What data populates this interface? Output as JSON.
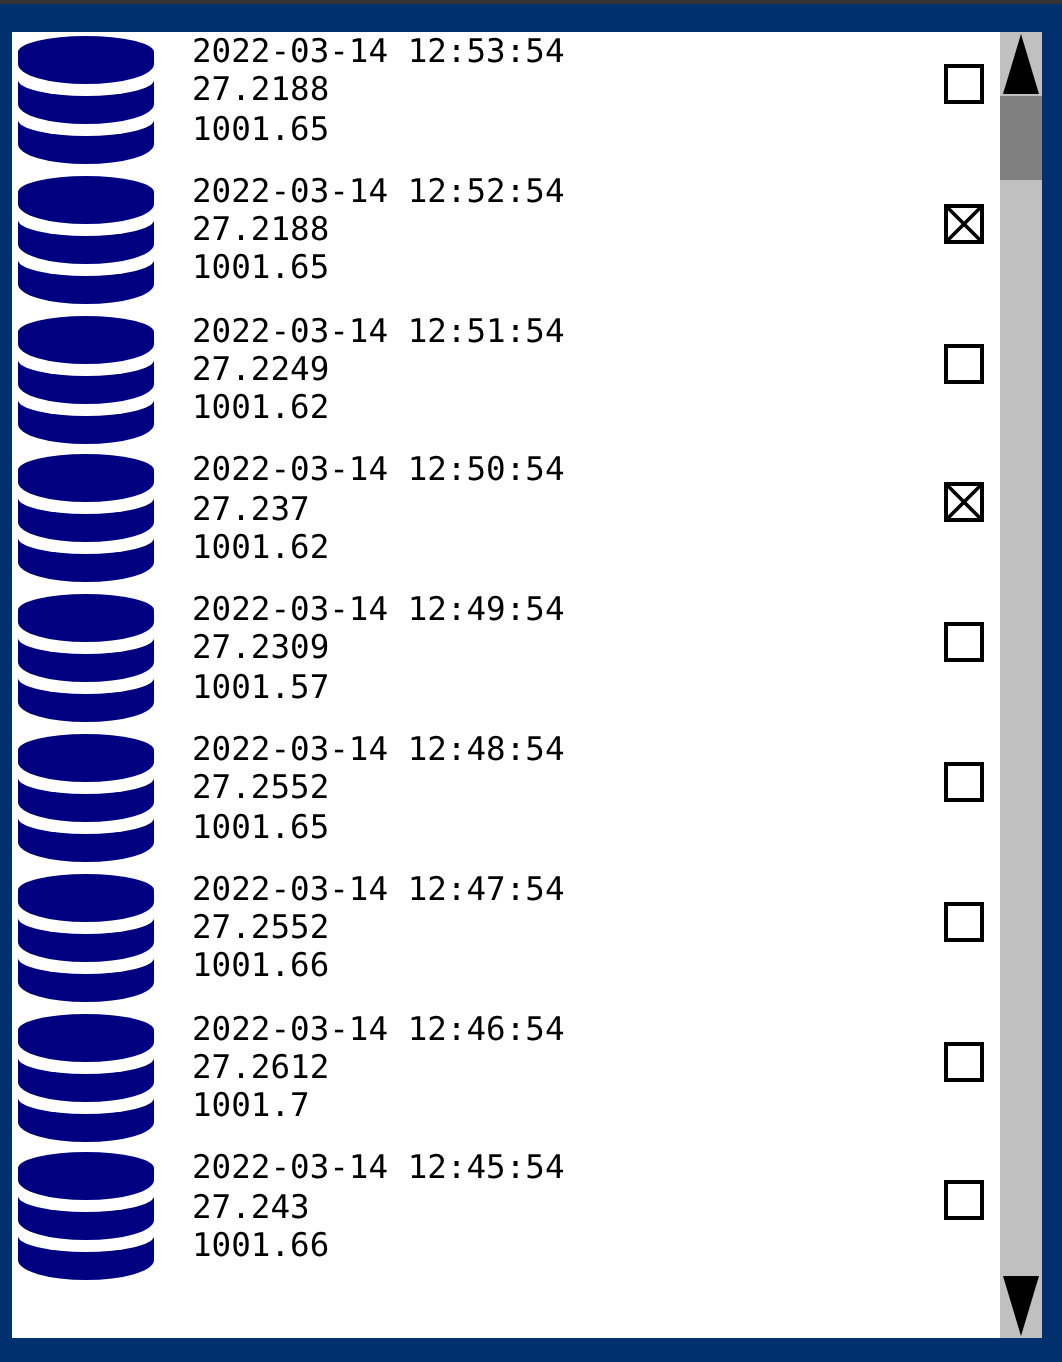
{
  "rows": [
    {
      "time": "2022-03-14 12:53:54",
      "value_1": "27.2188",
      "value_2": "1001.65",
      "checked": false
    },
    {
      "time": "2022-03-14 12:52:54",
      "value_1": "27.2188",
      "value_2": "1001.65",
      "checked": true
    },
    {
      "time": "2022-03-14 12:51:54",
      "value_1": "27.2249",
      "value_2": "1001.62",
      "checked": false
    },
    {
      "time": "2022-03-14 12:50:54",
      "value_1": "27.237",
      "value_2": "1001.62",
      "checked": true
    },
    {
      "time": "2022-03-14 12:49:54",
      "value_1": "27.2309",
      "value_2": "1001.57",
      "checked": false
    },
    {
      "time": "2022-03-14 12:48:54",
      "value_1": "27.2552",
      "value_2": "1001.65",
      "checked": false
    },
    {
      "time": "2022-03-14 12:47:54",
      "value_1": "27.2552",
      "value_2": "1001.66",
      "checked": false
    },
    {
      "time": "2022-03-14 12:46:54",
      "value_1": "27.2612",
      "value_2": "1001.7",
      "checked": false
    },
    {
      "time": "2022-03-14 12:45:54",
      "value_1": "27.243",
      "value_2": "1001.66",
      "checked": false
    }
  ]
}
